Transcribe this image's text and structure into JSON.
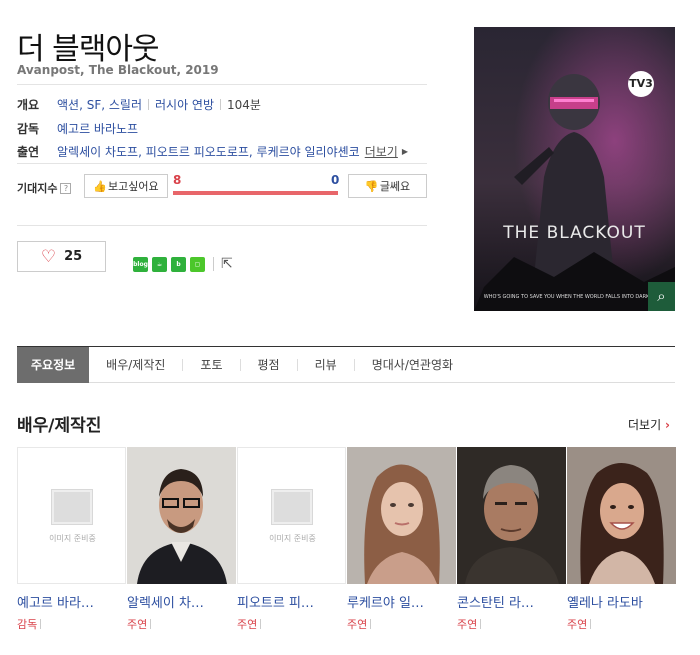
{
  "movie": {
    "title": "더 블랙아웃",
    "subtitle": "Avanpost, The Blackout, 2019"
  },
  "info": {
    "overview_label": "개요",
    "genres": "액션, SF, 스릴러",
    "country": "러시아 연방",
    "runtime": "104분",
    "director_label": "감독",
    "director": "예고르 바라노프",
    "cast_label": "출연",
    "cast": "알렉세이 차도프, 피오트르 피오도로프, 루케르야 일리야셴코",
    "cast_more": "더보기"
  },
  "expectation": {
    "label": "기대지수",
    "help": "?",
    "want_label": "보고싶어요",
    "want_count": "8",
    "meh_label": "글쎄요",
    "meh_count": "0",
    "want_ratio": 1.0,
    "bar_color": "#e8666a"
  },
  "like": {
    "count": "25"
  },
  "share": {
    "icons": [
      "blog-icon",
      "cafe-icon",
      "band-icon",
      "line-icon"
    ],
    "blog_label": "blog"
  },
  "poster": {
    "title": "THE BLACKOUT",
    "tagline": "WHO'S GOING TO SAVE YOU WHEN THE WORLD FALLS INTO DARKNESS?",
    "channel": "TV3"
  },
  "tabs": [
    "주요정보",
    "배우/제작진",
    "포토",
    "평점",
    "리뷰",
    "명대사/연관영화"
  ],
  "cast_section": {
    "title": "배우/제작진",
    "more": "더보기",
    "placeholder_text": "이미지 준비중",
    "people": [
      {
        "name": "예고르 바라…",
        "role": "감독",
        "photo": false
      },
      {
        "name": "알렉세이 차…",
        "role": "주연",
        "photo": true
      },
      {
        "name": "피오트르 피…",
        "role": "주연",
        "photo": false
      },
      {
        "name": "루케르야 일…",
        "role": "주연",
        "photo": true
      },
      {
        "name": "콘스탄틴 라…",
        "role": "주연",
        "photo": true
      },
      {
        "name": "옐레나 라도바",
        "role": "주연",
        "photo": true
      }
    ]
  },
  "colors": {
    "link": "#2d4fa0",
    "accent_red": "#d9424a",
    "tab_active": "#6d6d6d"
  }
}
